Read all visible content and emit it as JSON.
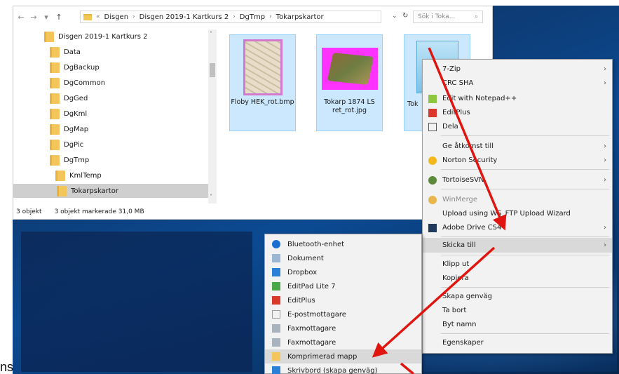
{
  "address": {
    "back": "←",
    "forward": "→",
    "recent": "▾",
    "up": "↑",
    "chevron": "«",
    "segments": [
      "Disgen",
      "Disgen 2019-1 Kartkurs 2",
      "DgTmp",
      "Tokarpskartor"
    ],
    "separator": "›",
    "dropdown": "⌄",
    "refresh": "↻",
    "search_placeholder": "Sök i Toka...",
    "search_icon": "⌕"
  },
  "tree": {
    "root": "Disgen 2019-1 Kartkurs 2",
    "items": [
      "Data",
      "DgBackup",
      "DgCommon",
      "DgGed",
      "DgKml",
      "DgMap",
      "DgPic",
      "DgTmp",
      "KmlTemp",
      "Tokarpskartor"
    ],
    "scroll_up": "˄",
    "scroll_down": "˅"
  },
  "files": [
    {
      "name": "Floby HEK_rot.bmp"
    },
    {
      "name": "Tokarp 1874 LS ret_rot.jpg"
    },
    {
      "name": "Tok"
    }
  ],
  "status": {
    "count": "3 objekt",
    "selected": "3 objekt markerade 31,0 MB"
  },
  "context_menu": {
    "items": [
      {
        "label": "7-Zip",
        "submenu": true
      },
      {
        "label": "CRC SHA",
        "submenu": true
      },
      {
        "label": "Edit with Notepad++"
      },
      {
        "label": "EditPlus"
      },
      {
        "label": "Dela"
      },
      {
        "label": "Ge åtkomst till",
        "submenu": true
      },
      {
        "label": "Norton Security",
        "submenu": true
      },
      {
        "label": "TortoiseSVN",
        "submenu": true
      },
      {
        "label": "WinMerge",
        "disabled": true
      },
      {
        "label": "Upload using WS_FTP Upload Wizard"
      },
      {
        "label": "Adobe Drive CS4",
        "submenu": true
      },
      {
        "label": "Skicka till",
        "submenu": true,
        "hover": true
      },
      {
        "label": "Klipp ut"
      },
      {
        "label": "Kopiera"
      },
      {
        "label": "Skapa genväg"
      },
      {
        "label": "Ta bort"
      },
      {
        "label": "Byt namn"
      },
      {
        "label": "Egenskaper"
      }
    ],
    "submenu_arrow": "›"
  },
  "send_to_menu": {
    "items": [
      {
        "label": "Bluetooth-enhet"
      },
      {
        "label": "Dokument"
      },
      {
        "label": "Dropbox"
      },
      {
        "label": "EditPad Lite 7"
      },
      {
        "label": "EditPlus"
      },
      {
        "label": "E-postmottagare"
      },
      {
        "label": "Faxmottagare"
      },
      {
        "label": "Faxmottagare"
      },
      {
        "label": "Komprimerad mapp",
        "hover": true
      },
      {
        "label": "Skrivbord (skapa genväg)"
      }
    ]
  },
  "colors": {
    "selection": "#cce8ff",
    "menu_bg": "#f2f2f2",
    "arrow": "#e0150f"
  },
  "corner_text": "ns"
}
